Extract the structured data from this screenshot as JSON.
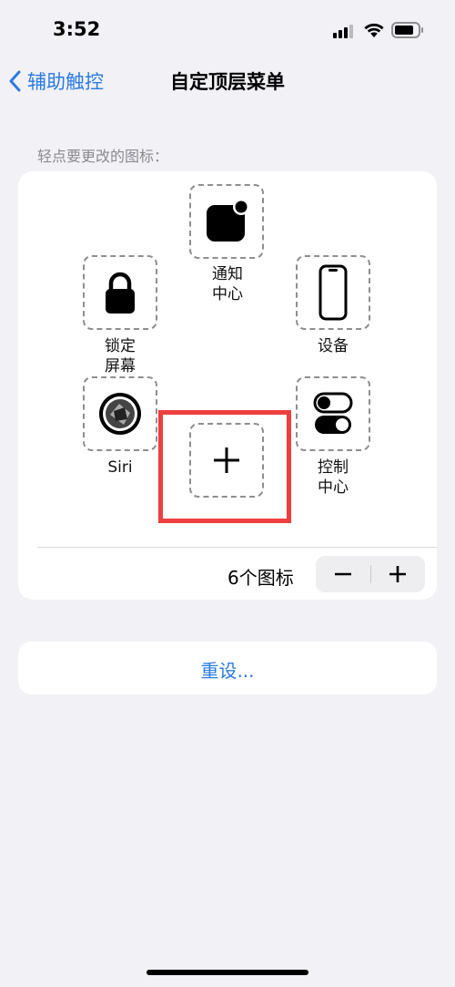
{
  "status": {
    "time": "3:52"
  },
  "nav": {
    "back_label": "辅助触控",
    "title": "自定顶层菜单"
  },
  "hint": "轻点要更改的图标：",
  "menu": {
    "slots": [
      {
        "label": "通知\n中心",
        "icon": "notification-center-icon"
      },
      {
        "label": "设备",
        "icon": "device-icon"
      },
      {
        "label": "控制\n中心",
        "icon": "control-center-icon"
      },
      {
        "label": "",
        "icon": "plus-icon"
      },
      {
        "label": "Siri",
        "icon": "siri-icon"
      },
      {
        "label": "锁定\n屏幕",
        "icon": "lock-screen-icon"
      }
    ],
    "count_label": "6个图标"
  },
  "reset": {
    "label": "重设..."
  },
  "colors": {
    "accent": "#2c7be5",
    "highlight": "#ee3f3f",
    "background": "#f1f1f6"
  }
}
